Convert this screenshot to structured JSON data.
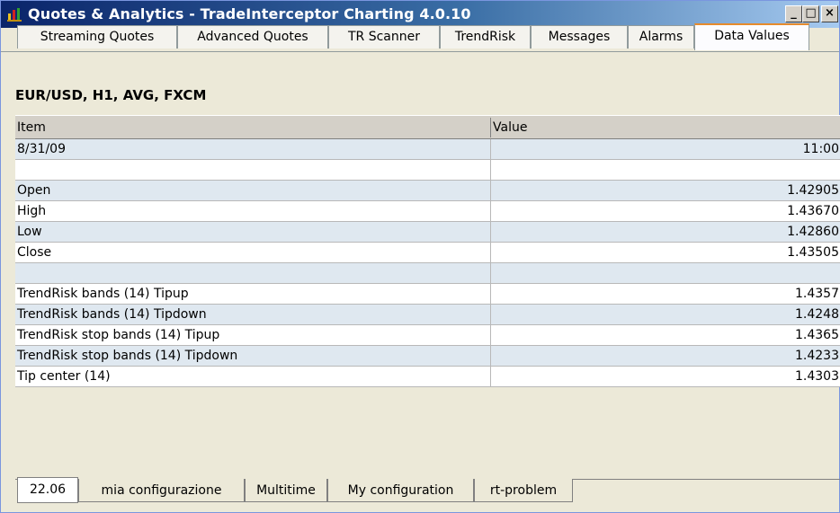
{
  "window": {
    "title": "Quotes & Analytics - TradeInterceptor Charting 4.0.10",
    "minimize_label": "_",
    "maximize_label": "□",
    "close_label": "×"
  },
  "tabs": [
    {
      "label": "Streaming Quotes"
    },
    {
      "label": "Advanced Quotes"
    },
    {
      "label": "TR Scanner"
    },
    {
      "label": "TrendRisk"
    },
    {
      "label": "Messages"
    },
    {
      "label": "Alarms"
    },
    {
      "label": "Data Values",
      "active": true
    }
  ],
  "symbol_header": "EUR/USD, H1, AVG, FXCM",
  "table": {
    "columns": [
      "Item",
      "Value"
    ],
    "rows": [
      {
        "item": "8/31/09",
        "value": "11:00"
      },
      {
        "item": "",
        "value": ""
      },
      {
        "item": "Open",
        "value": "1.42905"
      },
      {
        "item": "High",
        "value": "1.43670"
      },
      {
        "item": "Low",
        "value": "1.42860"
      },
      {
        "item": "Close",
        "value": "1.43505"
      },
      {
        "item": "",
        "value": ""
      },
      {
        "item": "TrendRisk bands (14) Tipup",
        "value": "1.4357"
      },
      {
        "item": "TrendRisk bands (14) Tipdown",
        "value": "1.4248"
      },
      {
        "item": "TrendRisk stop bands (14) Tipup",
        "value": "1.4365"
      },
      {
        "item": "TrendRisk stop bands (14) Tipdown",
        "value": "1.4233"
      },
      {
        "item": "Tip center (14)",
        "value": "1.4303"
      }
    ]
  },
  "bottom_tabs": [
    {
      "label": "22.06",
      "active": true
    },
    {
      "label": "mia configurazione"
    },
    {
      "label": "Multitime"
    },
    {
      "label": "My configuration"
    },
    {
      "label": "rt-problem"
    }
  ],
  "colors": {
    "row_alt": "#dfe8f0",
    "title_bar": "#0a246a",
    "active_tab_accent": "#e68b2c"
  }
}
